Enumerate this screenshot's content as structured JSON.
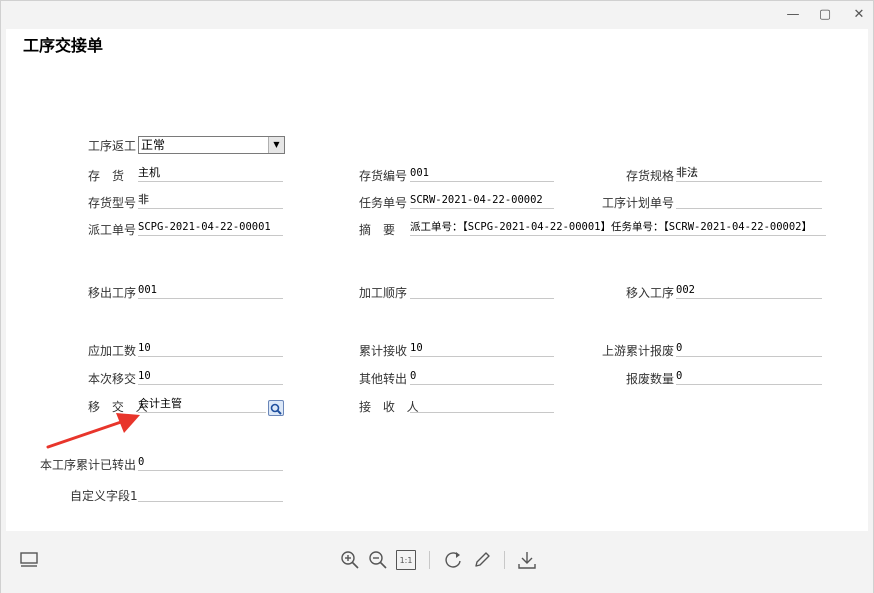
{
  "window": {
    "minimize_glyph": "—",
    "maximize_glyph": "▢",
    "close_glyph": "✕"
  },
  "doc": {
    "title": "工序交接单",
    "process_rework": {
      "label": "工序返工",
      "value": "正常"
    },
    "inventory": {
      "label": "存　货",
      "value": "主机"
    },
    "inventory_code": {
      "label": "存货编号",
      "value": "001"
    },
    "inventory_spec": {
      "label": "存货规格",
      "value": "非法"
    },
    "inventory_model": {
      "label": "存货型号",
      "value": "非"
    },
    "task_no": {
      "label": "任务单号",
      "value": "SCRW-2021-04-22-00002"
    },
    "process_plan_no": {
      "label": "工序计划单号",
      "value": ""
    },
    "dispatch_no": {
      "label": "派工单号",
      "value": "SCPG-2021-04-22-00001"
    },
    "summary": {
      "label": "摘　要",
      "value": "派工单号：【SCPG-2021-04-22-00001】任务单号：【SCRW-2021-04-22-00002】"
    },
    "out_process": {
      "label": "移出工序",
      "value": "001"
    },
    "process_order": {
      "label": "加工顺序",
      "value": ""
    },
    "in_process": {
      "label": "移入工序",
      "value": "002"
    },
    "due_qty": {
      "label": "应加工数",
      "value": "10"
    },
    "cum_received": {
      "label": "累计接收",
      "value": "10"
    },
    "upstream_scrap": {
      "label": "上游累计报废",
      "value": "0"
    },
    "this_transfer": {
      "label": "本次移交",
      "value": "10"
    },
    "other_out": {
      "label": "其他转出",
      "value": "0"
    },
    "scrap_qty": {
      "label": "报废数量",
      "value": "0"
    },
    "transferor": {
      "label": "移 交 人",
      "value": "会计主管"
    },
    "receiver": {
      "label": "接 收 人",
      "value": ""
    },
    "cum_transferred": {
      "label": "本工序累计已转出",
      "value": "0"
    },
    "custom_field": {
      "label": "自定义字段1",
      "value": ""
    }
  },
  "colors": {
    "arrow": "#e8352b",
    "background": "#f3f3f3",
    "document": "#ffffff"
  },
  "toolbar": {
    "icons": [
      "layout-icon",
      "zoom-in-icon",
      "zoom-out-icon",
      "actual-size-icon",
      "rotate-icon",
      "edit-pen-icon",
      "download-icon"
    ],
    "actual_size_label": "1:1"
  }
}
